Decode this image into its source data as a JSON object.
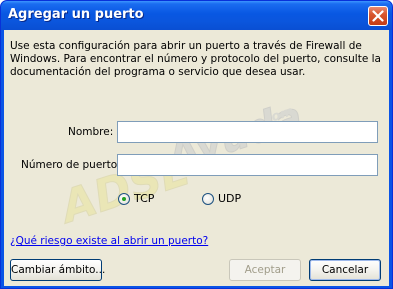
{
  "window": {
    "title": "Agregar un puerto"
  },
  "dialog": {
    "description": "Use esta configuración para abrir un puerto a través de Firewall de Windows. Para encontrar el número y protocolo del puerto, consulte la documentación del programa o servicio que desea usar.",
    "name_label": "Nombre:",
    "name_value": "",
    "port_label": "Número de puerto:",
    "port_value": "",
    "protocol_options": [
      "TCP",
      "UDP"
    ],
    "protocol_selected": "TCP",
    "risk_link": "¿Qué riesgo existe al abrir un puerto?",
    "change_scope_button": "Cambiar ámbito...",
    "accept_button": "Aceptar",
    "cancel_button": "Cancelar"
  },
  "watermark": {
    "text": "ADSLAyuda.com"
  },
  "colors": {
    "titlebar": "#0a54e6",
    "dialog_bg": "#ece9d8",
    "link": "#0000ee"
  }
}
